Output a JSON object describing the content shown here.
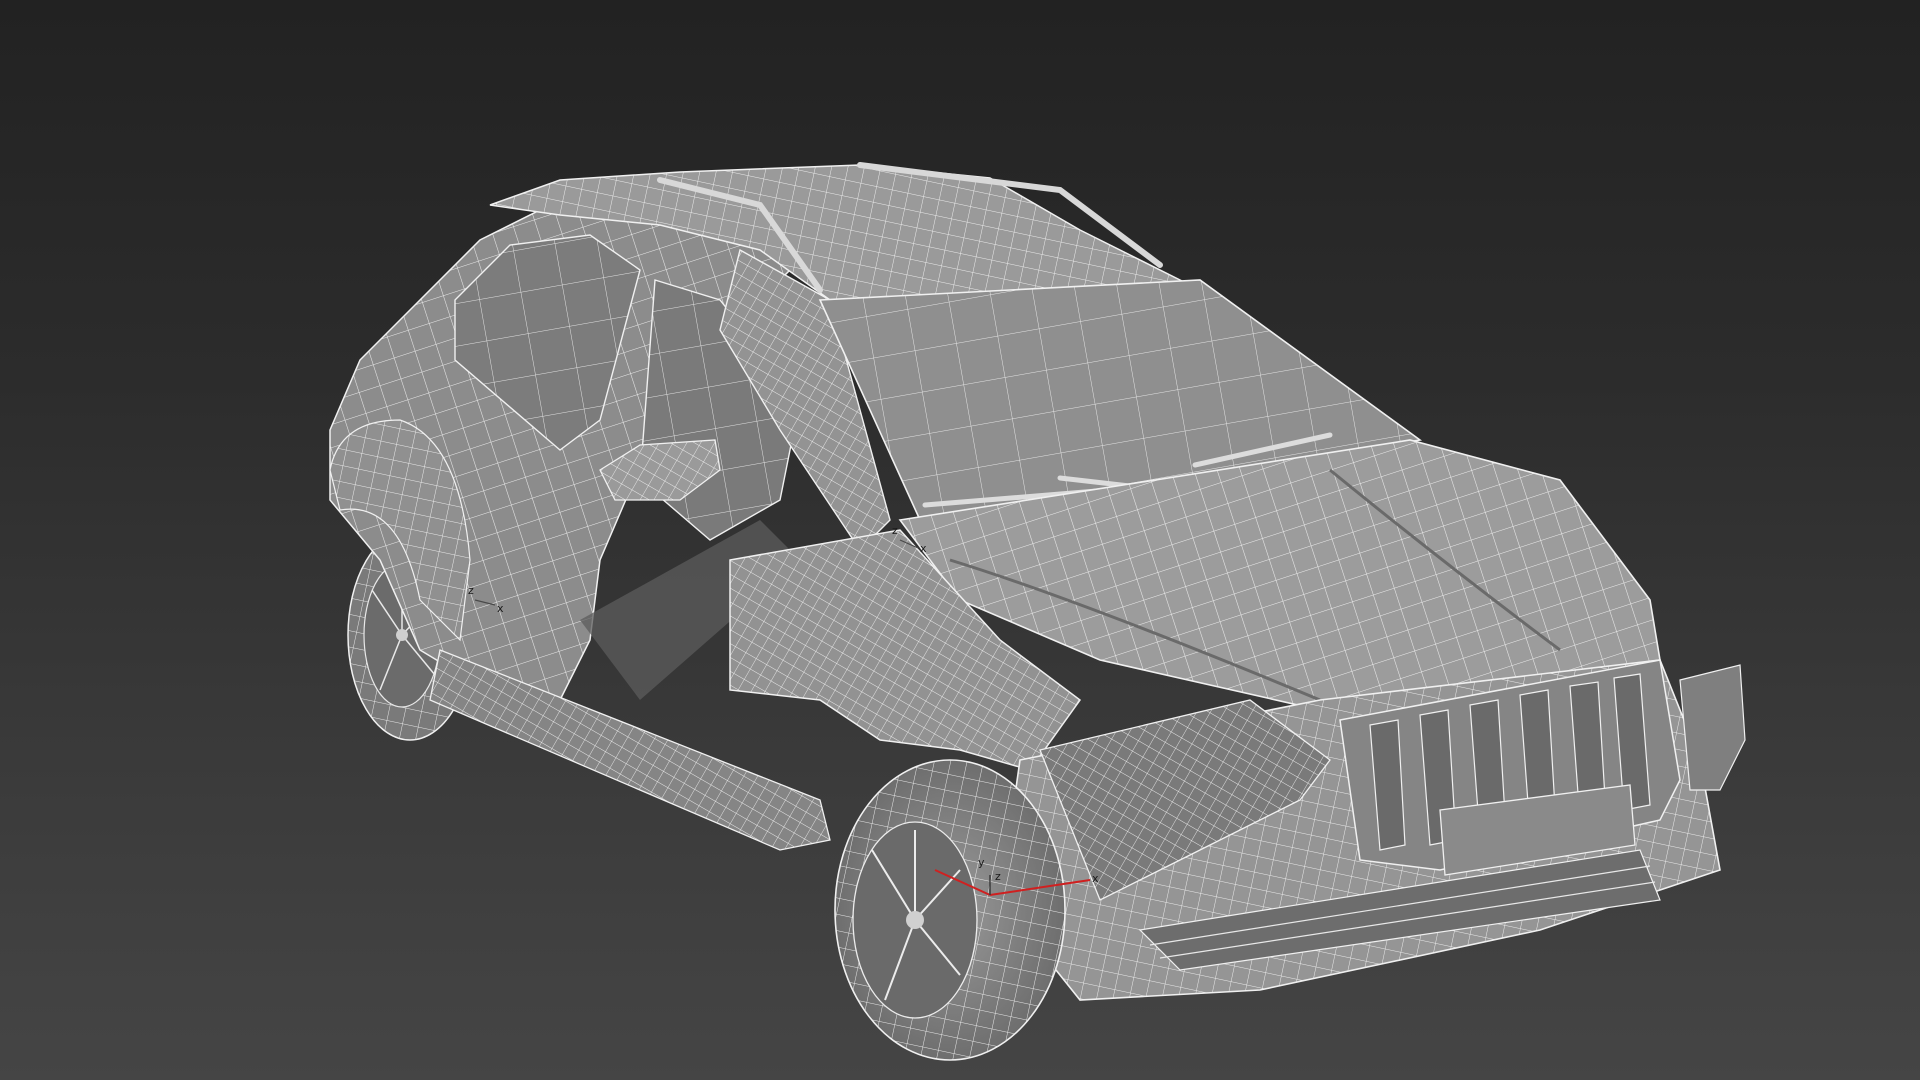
{
  "viewport": {
    "background_top": "#222222",
    "background_bottom": "#454545",
    "mode": "wireframe-on-shaded"
  },
  "model": {
    "name": "",
    "shaded_color": "#8e8e8e",
    "wire_color": "#f2f2f2",
    "shadow_color": "#5a5a5a"
  },
  "gizmos": {
    "front_wheel": {
      "x_label": "x",
      "y_label": "y",
      "z_label": "z",
      "axis_color": "#d02020"
    },
    "rear_wheel": {
      "x_label": "x",
      "z_label": "z"
    },
    "door": {
      "x_label": "x",
      "z_label": "z"
    }
  }
}
